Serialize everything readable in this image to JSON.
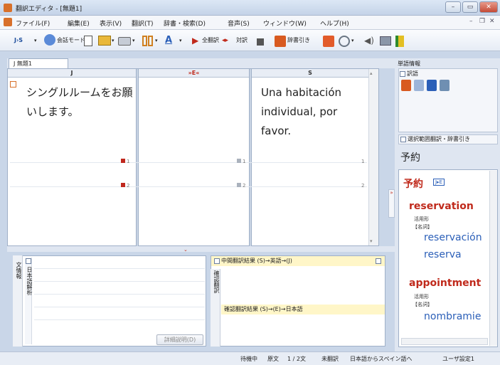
{
  "window": {
    "title": "翻訳エディタ - [無題1]",
    "min": "–",
    "max": "▭",
    "close": "✕"
  },
  "menu": [
    "ファイル(F)",
    "編集(E)",
    "表示(V)",
    "翻訳(T)",
    "辞書・検索(D)",
    "音声(S)",
    "ウィンドウ(W)",
    "ヘルプ(H)"
  ],
  "mdi_controls": {
    "min": "–",
    "restore": "❐",
    "close": "✕"
  },
  "toolbar": {
    "direction": "J›S",
    "kaiwa": "会話モード",
    "translate_all": "全翻訳",
    "parallel": "対訳",
    "jisho": "辞書引き"
  },
  "tab": "J 無題1",
  "columns": {
    "j": "J",
    "mid": "»E«",
    "s": "S"
  },
  "source_text": "シングルルームをお願いします。",
  "target_text": "Una habitación individual, por favor.",
  "row_marks": {
    "r1": "1",
    "r2": "2"
  },
  "bottom_left": {
    "tab1": "文情報",
    "tab2": "日本語解析",
    "button": "詳細説明(D)"
  },
  "bottom_right": {
    "side": "確認翻訳",
    "mid_result": "中間翻訳結果 (S)→英語→(J)",
    "confirm_result": "確認翻訳結果 (S)→(E)→日本語"
  },
  "right": {
    "header": "単語情報",
    "sub": "訳語",
    "selection_check": "選択範囲翻訳・辞書引き",
    "query": "予約",
    "entry": "予約",
    "badge": "J▸E",
    "meanings": [
      {
        "word": "reservation",
        "pos_label": "活用形",
        "pos": "【名詞】",
        "trans": [
          "reservación",
          "reserva"
        ]
      },
      {
        "word": "appointment",
        "pos_label": "活用形",
        "pos": "【名詞】",
        "trans": [
          "nombramie"
        ]
      }
    ]
  },
  "status": {
    "state": "待機中",
    "type": "原文",
    "pos": "1 / 2文",
    "untranslated": "未翻訳",
    "direction": "日本語からスペイン語へ",
    "user": "ユーザ設定1"
  }
}
